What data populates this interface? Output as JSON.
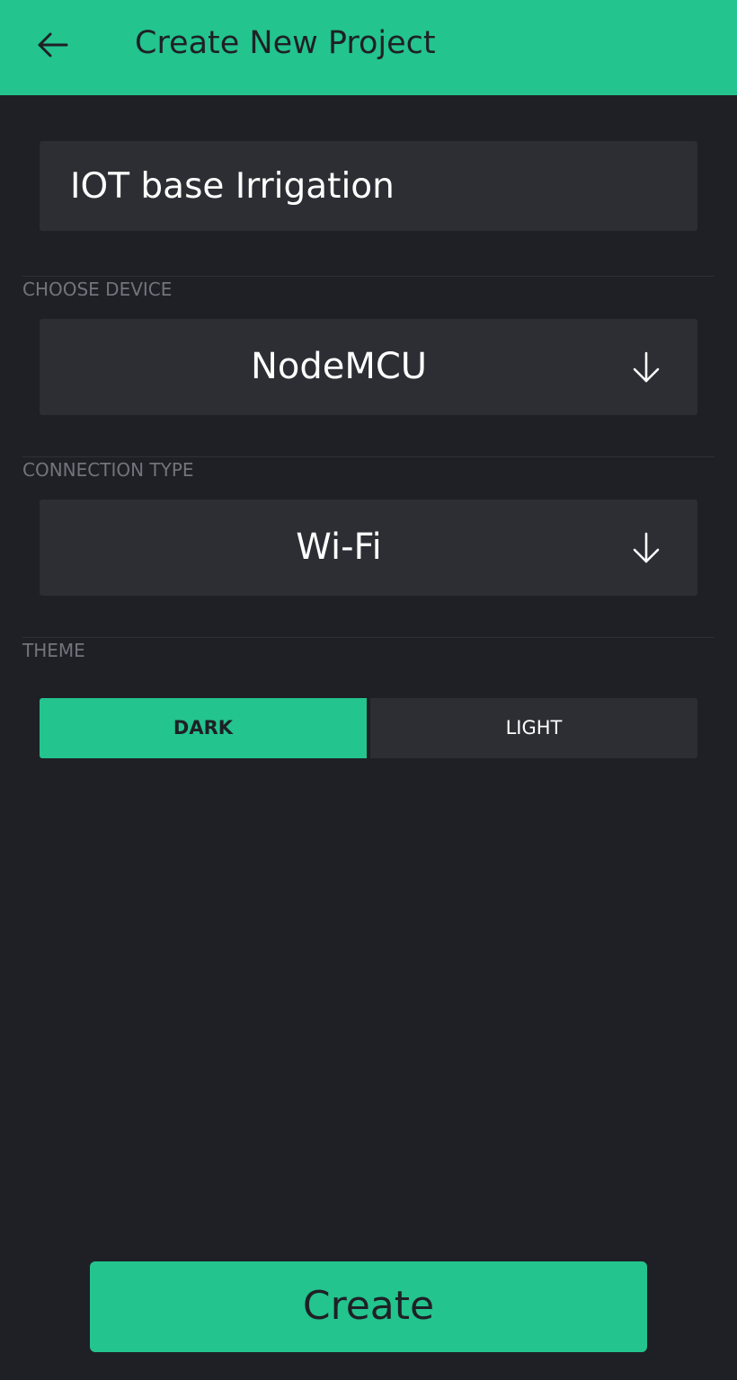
{
  "colors": {
    "accent": "#23c48e",
    "background": "#1f2025",
    "field": "#2d2e33",
    "label": "#72747c"
  },
  "header": {
    "title": "Create New Project",
    "back_icon": "arrow-left-icon"
  },
  "project_name": {
    "value": "IOT base Irrigation"
  },
  "device": {
    "label": "CHOOSE DEVICE",
    "value": "NodeMCU",
    "icon": "arrow-down-icon"
  },
  "connection": {
    "label": "CONNECTION TYPE",
    "value": "Wi-Fi",
    "icon": "arrow-down-icon"
  },
  "theme": {
    "label": "THEME",
    "options": [
      "DARK",
      "LIGHT"
    ],
    "selected": "DARK"
  },
  "create_button": {
    "label": "Create"
  }
}
